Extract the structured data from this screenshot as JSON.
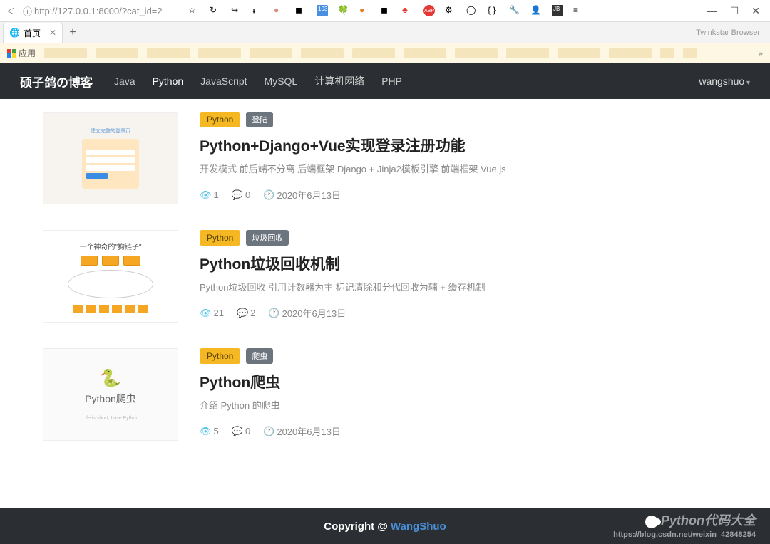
{
  "browser": {
    "url": "http://127.0.0.1:8000/?cat_id=2",
    "tab_title": "首页",
    "branding": "Twinkstar Browser",
    "apps_label": "应用"
  },
  "navbar": {
    "brand": "硕子鸽の博客",
    "items": [
      "Java",
      "Python",
      "JavaScript",
      "MySQL",
      "计算机网络",
      "PHP"
    ],
    "active_index": 1,
    "user": "wangshuo"
  },
  "posts": [
    {
      "category": "Python",
      "subtag": "登陆",
      "title": "Python+Django+Vue实现登录注册功能",
      "desc": "开发模式 前后端不分离 后端框架 Django + Jinja2模板引擎 前端框架 Vue.js",
      "views": "1",
      "comments": "0",
      "date": "2020年6月13日"
    },
    {
      "category": "Python",
      "subtag": "垃圾回收",
      "title": "Python垃圾回收机制",
      "desc": "Python垃圾回收 引用计数器为主 标记清除和分代回收为辅 + 缓存机制",
      "views": "21",
      "comments": "2",
      "date": "2020年6月13日",
      "thumb_title": "一个神奇的\"狗链子\""
    },
    {
      "category": "Python",
      "subtag": "爬虫",
      "title": "Python爬虫",
      "desc": "介绍 Python 的爬虫",
      "views": "5",
      "comments": "0",
      "date": "2020年6月13日",
      "thumb_text": "Python爬虫",
      "thumb_sub": "Life is short, I use Python"
    }
  ],
  "footer": {
    "copyright": "Copyright @",
    "author": "WangShuo"
  },
  "watermark": {
    "line1": "Python代码大全",
    "line2": "https://blog.csdn.net/weixin_42848254"
  }
}
